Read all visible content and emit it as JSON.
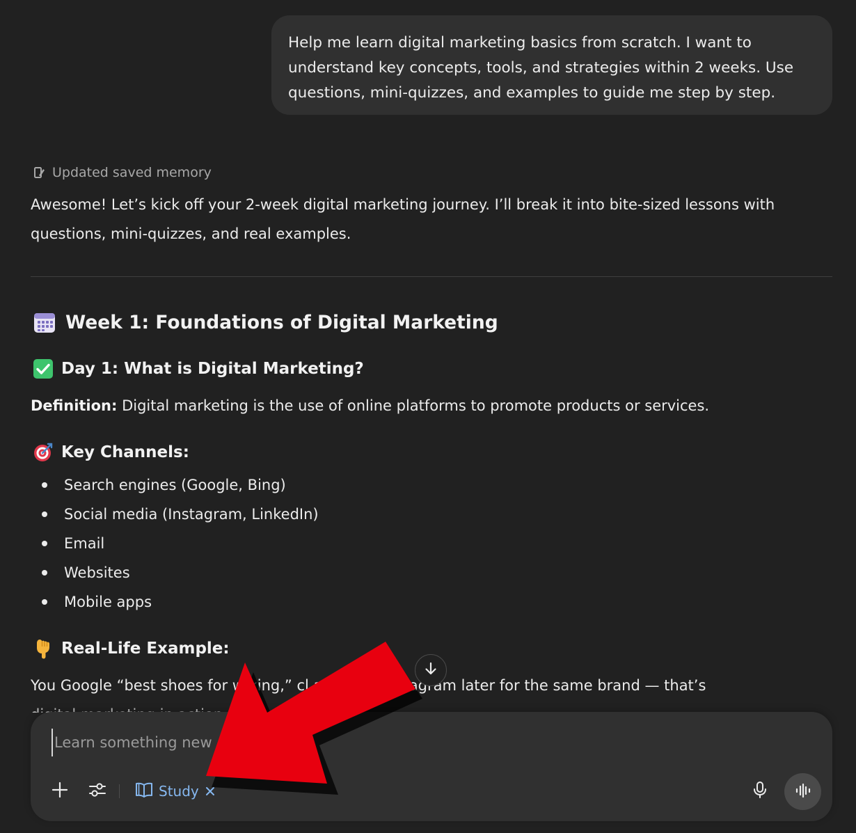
{
  "conversation": {
    "user_message": "Help me learn digital marketing basics from scratch. I want to understand key concepts, tools, and strategies within 2 weeks. Use questions, mini-quizzes, and examples to guide me step by step.",
    "memory_note": "Updated saved memory",
    "intro": "Awesome! Let’s kick off your 2-week digital marketing journey. I’ll break it into bite-sized lessons with questions, mini-quizzes, and real examples.",
    "week_heading": "Week 1: Foundations of Digital Marketing",
    "day_heading": "Day 1: What is Digital Marketing?",
    "definition_label": "Definition:",
    "definition_text": " Digital marketing is the use of online platforms to promote products or services.",
    "channels_heading": "Key Channels:",
    "channels": [
      "Search engines (Google, Bing)",
      "Social media (Instagram, LinkedIn)",
      "Email",
      "Websites",
      "Mobile apps"
    ],
    "example_heading": "Real-Life Example:",
    "example_text": "You Google “best shoes for w king,” cl an ad on Instagram later for the same brand — that’s",
    "example_text_cont": "digital marketing in action."
  },
  "composer": {
    "placeholder": "Learn something new",
    "mode_label": "Study"
  },
  "colors": {
    "background": "#212121",
    "bubble": "#303030",
    "accent_study": "#86b8f0",
    "annotation_arrow": "#e8000f"
  },
  "icons": {
    "memory": "memory-pencil-icon",
    "week": "calendar-icon",
    "day": "check-mark-button-icon",
    "channels": "direct-hit-target-icon",
    "example": "backhand-pointing-down-icon",
    "scroll": "arrow-down-icon",
    "attach": "plus-icon",
    "tools": "sliders-icon",
    "study": "open-book-icon",
    "remove_mode": "close-icon",
    "mic": "microphone-icon",
    "voice": "voice-waveform-icon"
  }
}
